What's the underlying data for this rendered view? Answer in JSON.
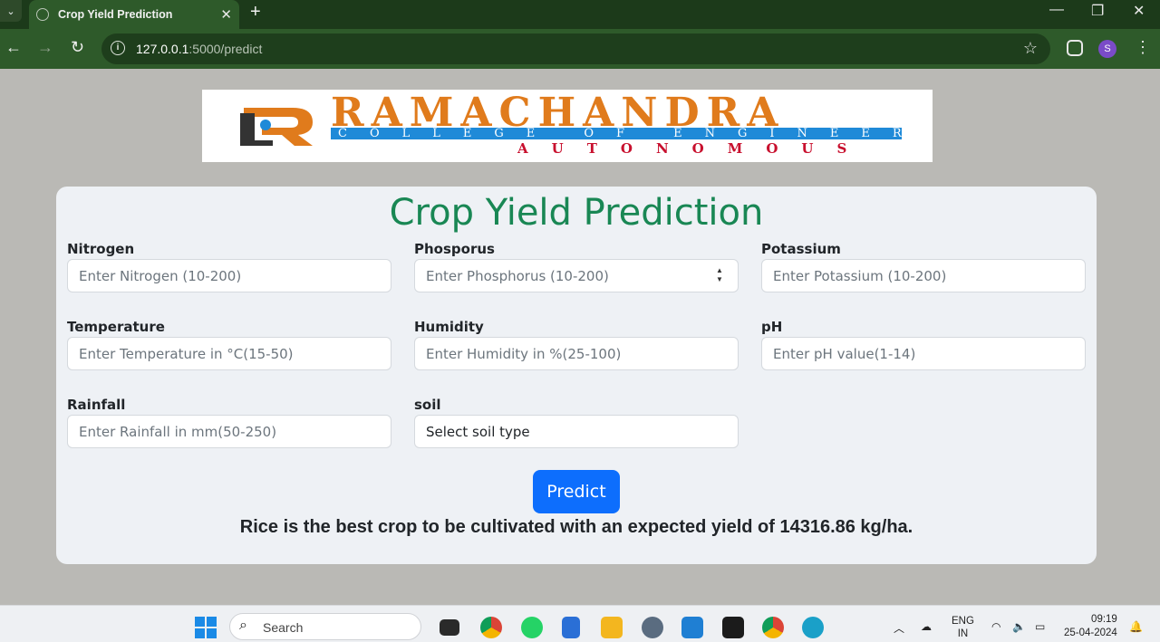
{
  "browser": {
    "tab_title": "Crop Yield Prediction",
    "url_host": "127.0.0.1",
    "url_path": ":5000/predict",
    "profile_initial": "S"
  },
  "banner": {
    "brand": "RAMACHANDRA",
    "subtitle": "COLLEGE OF ENGINEERING",
    "tagline": "AUTONOMOUS"
  },
  "page": {
    "title": "Crop Yield Prediction",
    "fields": {
      "nitrogen": {
        "label": "Nitrogen",
        "placeholder": "Enter Nitrogen (10-200)"
      },
      "phosphorus": {
        "label": "Phosporus",
        "placeholder": "Enter Phosphorus (10-200)"
      },
      "potassium": {
        "label": "Potassium",
        "placeholder": "Enter Potassium (10-200)"
      },
      "temperature": {
        "label": "Temperature",
        "placeholder": "Enter Temperature in °C(15-50)"
      },
      "humidity": {
        "label": "Humidity",
        "placeholder": "Enter Humidity in %(25-100)"
      },
      "ph": {
        "label": "pH",
        "placeholder": "Enter pH value(1-14)"
      },
      "rainfall": {
        "label": "Rainfall",
        "placeholder": "Enter Rainfall in mm(50-250)"
      },
      "soil": {
        "label": "soil",
        "selected": "Select soil type"
      }
    },
    "predict_label": "Predict",
    "result": "Rice is the best crop to be cultivated with an expected yield of 14316.86 kg/ha."
  },
  "taskbar": {
    "search_label": "Search",
    "lang_line1": "ENG",
    "lang_line2": "IN",
    "time": "09:19",
    "date": "25-04-2024"
  },
  "colors": {
    "title_green": "#198754",
    "primary_blue": "#0d6efd",
    "browser_green": "#2e5a2a",
    "brand_orange": "#e07b1c"
  }
}
